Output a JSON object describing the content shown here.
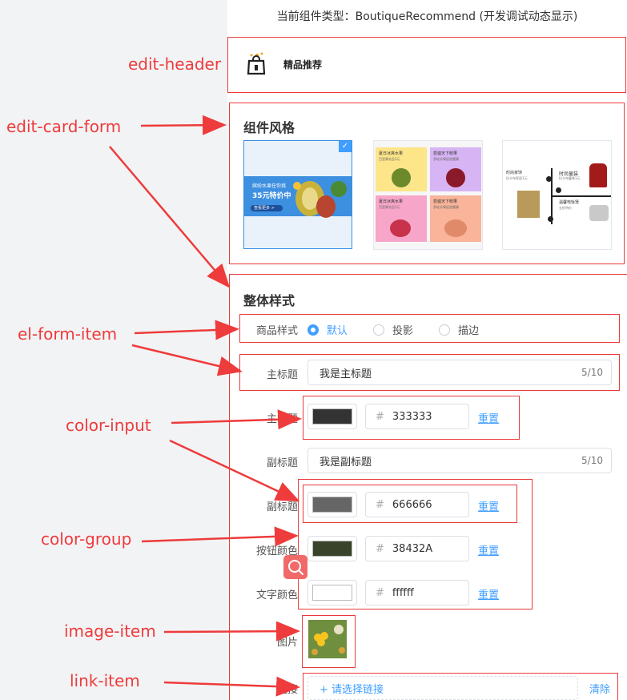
{
  "component_type_line": "当前组件类型：BoutiqueRecommend (开发调试动态显示)",
  "annotations": {
    "edit_header": "edit-header",
    "edit_card_form": "edit-card-form",
    "el_form_item": "el-form-item",
    "color_input": "color-input",
    "color_group": "color-group",
    "image_item": "image-item",
    "link_item": "link-item"
  },
  "header": {
    "title": "精品推荐",
    "icon": "boutique-bag-icon"
  },
  "component_style": {
    "title": "组件风格",
    "cards": [
      {
        "name": "style-1",
        "selected": true,
        "banner_line1": "缤纷水果任你挑",
        "banner_line2": "35元特价中",
        "banner_button": "查看更多 >"
      },
      {
        "name": "style-2",
        "selected": false,
        "tiles": [
          {
            "title": "夏日冰爽水果",
            "sub": "百里果冻品1元",
            "color": "#fde58a"
          },
          {
            "title": "尝遍天下鲜果",
            "sub": "多吃水果促进健康",
            "color": "#d7b4f3"
          },
          {
            "title": "夏日冰爽水果",
            "sub": "百里果冻品1元",
            "color": "#f7a6c9"
          },
          {
            "title": "尝遍天下鲜果",
            "sub": "多吃水果促进健康",
            "color": "#f9b49a"
          }
        ]
      },
      {
        "name": "style-3",
        "selected": false,
        "texts": [
          "时尚家饰",
          "时尚童装",
          "拉卡布家居1元",
          "拉卡布童装1元",
          "温馨电饭煲",
          "五折特价"
        ]
      }
    ]
  },
  "overall_style": {
    "title": "整体样式",
    "product_style": {
      "label": "商品样式",
      "options": [
        "默认",
        "投影",
        "描边"
      ],
      "selected": "默认"
    },
    "main_title": {
      "label": "主标题",
      "value": "我是主标题",
      "count": "5/10"
    },
    "main_title_color": {
      "label": "主标题",
      "hex": "333333",
      "color": "#333333",
      "reset": "重置"
    },
    "sub_title": {
      "label": "副标题",
      "value": "我是副标题",
      "count": "5/10"
    },
    "sub_title_color": {
      "label": "副标题",
      "hex": "666666",
      "color": "#666666",
      "reset": "重置"
    },
    "button_color": {
      "label": "按钮颜色",
      "hex": "38432A",
      "color": "#38432A",
      "reset": "重置"
    },
    "text_color": {
      "label": "文字颜色",
      "hex": "ffffff",
      "color": "#ffffff",
      "reset": "重置"
    },
    "image": {
      "label": "图片"
    },
    "link": {
      "label": "链接",
      "placeholder": "+ 请选择链接",
      "clear": "清除"
    }
  },
  "colors": {
    "accent": "#409eff",
    "annotation": "#ee3b3b"
  }
}
